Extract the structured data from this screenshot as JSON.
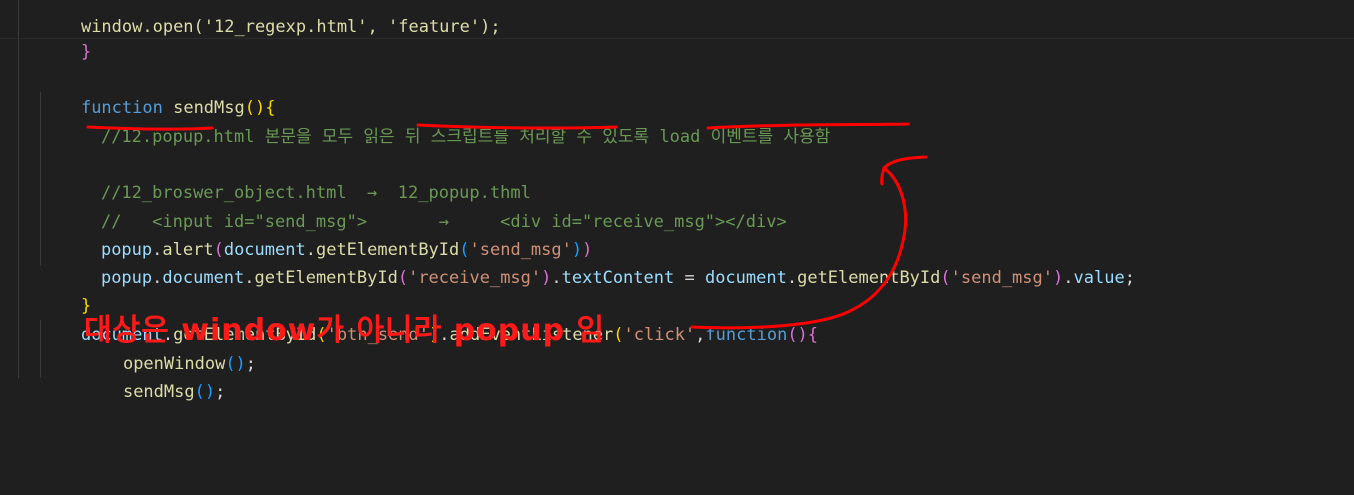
{
  "code": {
    "l0": "window.open('12_regexp.html', 'feature');",
    "l1": "}",
    "l3_kw": "function",
    "l3_fn": "sendMsg",
    "l4_comment_a": "//12.popup.html",
    "l4_comment_b": " 본문을 모두 읽은 뒤 스크립트를 처리할 수 있도록 load 이벤트를 사용함",
    "l6_comment": "//12_broswer_object.html  →  12_popup.thml",
    "l7_comment": "//   <input id=\"send_msg\">       →     <div id=\"receive_msg\"></div>",
    "l8_obj": "popup",
    "l8_fn": "alert",
    "l8_doc": "document",
    "l8_get": "getElementById",
    "l8_str": "'send_msg'",
    "l9_obj": "popup",
    "l9_doc": "document",
    "l9_get": "getElementById",
    "l9_str": "'receive_msg'",
    "l9_prop": "textContent",
    "l9_doc2": "document",
    "l9_get2": "getElementById",
    "l9_str2": "'send_msg'",
    "l9_val": "value",
    "l10": "}",
    "l11_doc": "document",
    "l11_get": "getElementById",
    "l11_str": "'btn_send'",
    "l11_add": "addEventListener",
    "l11_str2": "'click'",
    "l11_kw": "function",
    "l12_fn": "openWindow",
    "l13_fn": "sendMsg",
    "l_last": "})"
  },
  "annotation": {
    "text": "대상은 window가 아니라 popup 임",
    "color": "#ff1a1a"
  },
  "colors": {
    "background": "#1f1f1f",
    "keyword": "#569cd6",
    "function": "#dcdcaa",
    "variable": "#9cdcfe",
    "string": "#ce9178",
    "comment": "#6a9955"
  }
}
